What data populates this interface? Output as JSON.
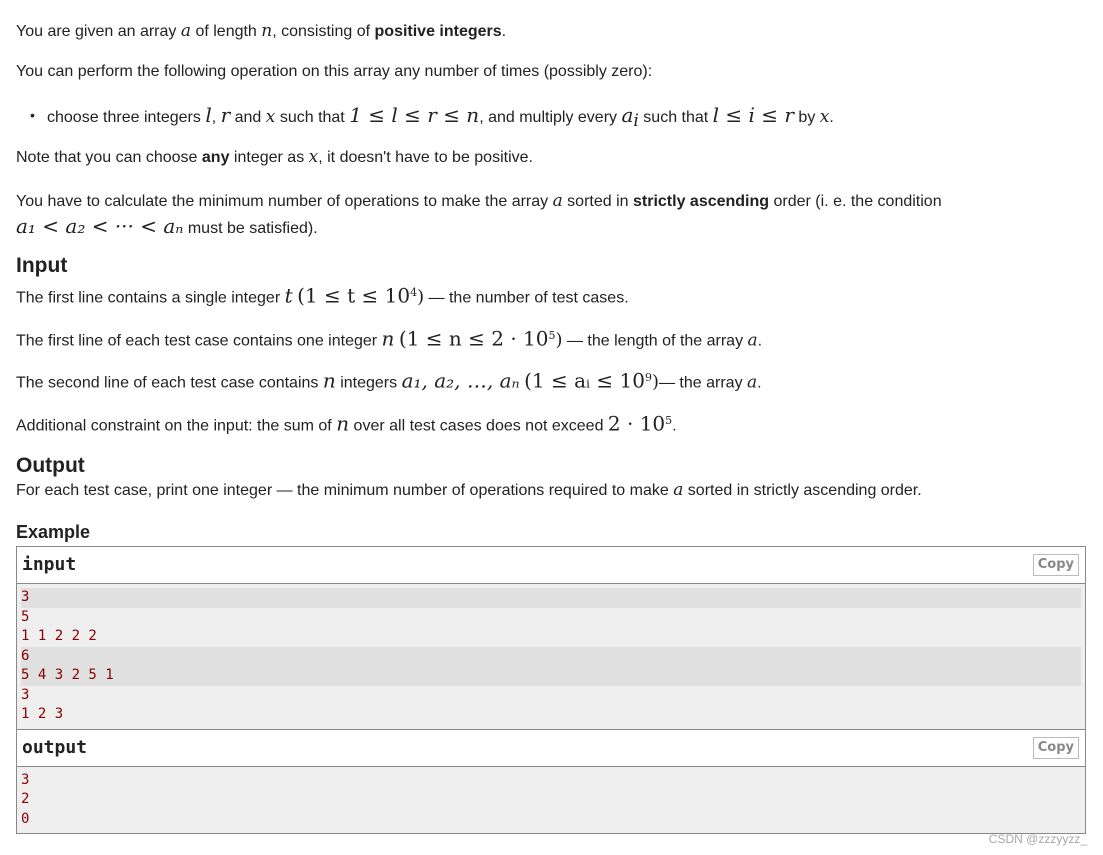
{
  "statement": {
    "p1": {
      "a": "You are given an array ",
      "v1": "a",
      "b": " of length ",
      "v2": "n",
      "c": ", consisting of ",
      "bold": "positive integers",
      "d": "."
    },
    "p2": "You can perform the following operation on this array any number of times (possibly zero):",
    "bullet": {
      "a": "choose three integers ",
      "l": "l",
      "comma": ", ",
      "r": "r",
      "and": " and ",
      "x": "x",
      "such": " such that ",
      "cond": "1 ≤ l ≤ r ≤ n",
      "b": ", and multiply every ",
      "ai_base": "a",
      "ai_sub": "i",
      "c": " such that ",
      "cond2": "l ≤ i ≤ r",
      "by": " by ",
      "x2": "x",
      "end": "."
    },
    "p3": {
      "a": "Note that you can choose ",
      "bold": "any",
      "b": " integer as ",
      "x": "x",
      "c": ", it doesn't have to be positive."
    },
    "p4": {
      "a": "You have to calculate the minimum number of operations to make the array ",
      "v": "a",
      "b": " sorted in ",
      "bold": "strictly ascending",
      "c": " order (i. e. the condition",
      "cond": "a₁ < a₂ < ··· < aₙ",
      "d": " must be satisfied)."
    }
  },
  "input_section": {
    "heading": "Input",
    "l1": {
      "a": "The first line contains a single integer ",
      "v": "t",
      "range": "(1 ≤ t ≤ 10",
      "exp": "4",
      "close": ")",
      "b": " — the number of test cases."
    },
    "l2": {
      "a": "The first line of each test case contains one integer ",
      "v": "n",
      "range": "(1 ≤ n ≤ 2 · 10",
      "exp": "5",
      "close": ")",
      "b": " — the length of the array ",
      "v2": "a",
      "c": "."
    },
    "l3": {
      "a": "The second line of each test case contains ",
      "v": "n",
      "b": " integers ",
      "seq": "a₁, a₂, …, aₙ",
      "range": "(1 ≤ aᵢ ≤ 10",
      "exp": "9",
      "close": ")",
      "c": "— the array ",
      "v2": "a",
      "d": "."
    },
    "l4": {
      "a": "Additional constraint on the input: the sum of ",
      "v": "n",
      "b": " over all test cases does not exceed ",
      "val": "2 · 10",
      "exp": "5",
      "c": "."
    }
  },
  "output_section": {
    "heading": "Output",
    "l1": {
      "a": "For each test case, print one integer — the minimum number of operations required to make ",
      "v": "a",
      "b": " sorted in strictly ascending order."
    }
  },
  "example": {
    "title": "Example",
    "input": {
      "label": "input",
      "copy_label": "Copy",
      "lines": [
        "3",
        "5",
        "1 1 2 2 2",
        "6",
        "5 4 3 2 5 1",
        "3",
        "1 2 3"
      ]
    },
    "output": {
      "label": "output",
      "copy_label": "Copy",
      "lines": [
        "3",
        "2",
        "0"
      ]
    }
  },
  "watermark": "CSDN @zzzyyzz_"
}
